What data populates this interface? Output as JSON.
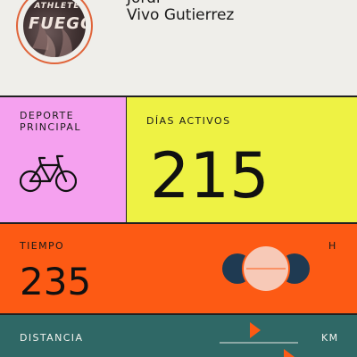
{
  "profile": {
    "name_first": "Jordi",
    "name_last": "Vivo Gutierrez",
    "avatar_text": "FUEGO",
    "avatar_top_text": "ATHLETE"
  },
  "sport": {
    "label_line1": "DEPORTE",
    "label_line2": "PRINCIPAL",
    "icon": "bicycle-icon"
  },
  "active_days": {
    "label": "DÍAS ACTIVOS",
    "value": "215"
  },
  "time": {
    "label": "TIEMPO",
    "value": "235",
    "unit": "H"
  },
  "distance": {
    "label": "DISTANCIA",
    "unit": "KM"
  },
  "colors": {
    "sport_bg": "#f5a1ef",
    "active_bg": "#eef244",
    "time_bg": "#fd5a14",
    "distance_bg": "#2f6866",
    "circle_dark": "#1f3a52",
    "circle_light": "#f7c9b7",
    "accent": "#fd5a14"
  }
}
